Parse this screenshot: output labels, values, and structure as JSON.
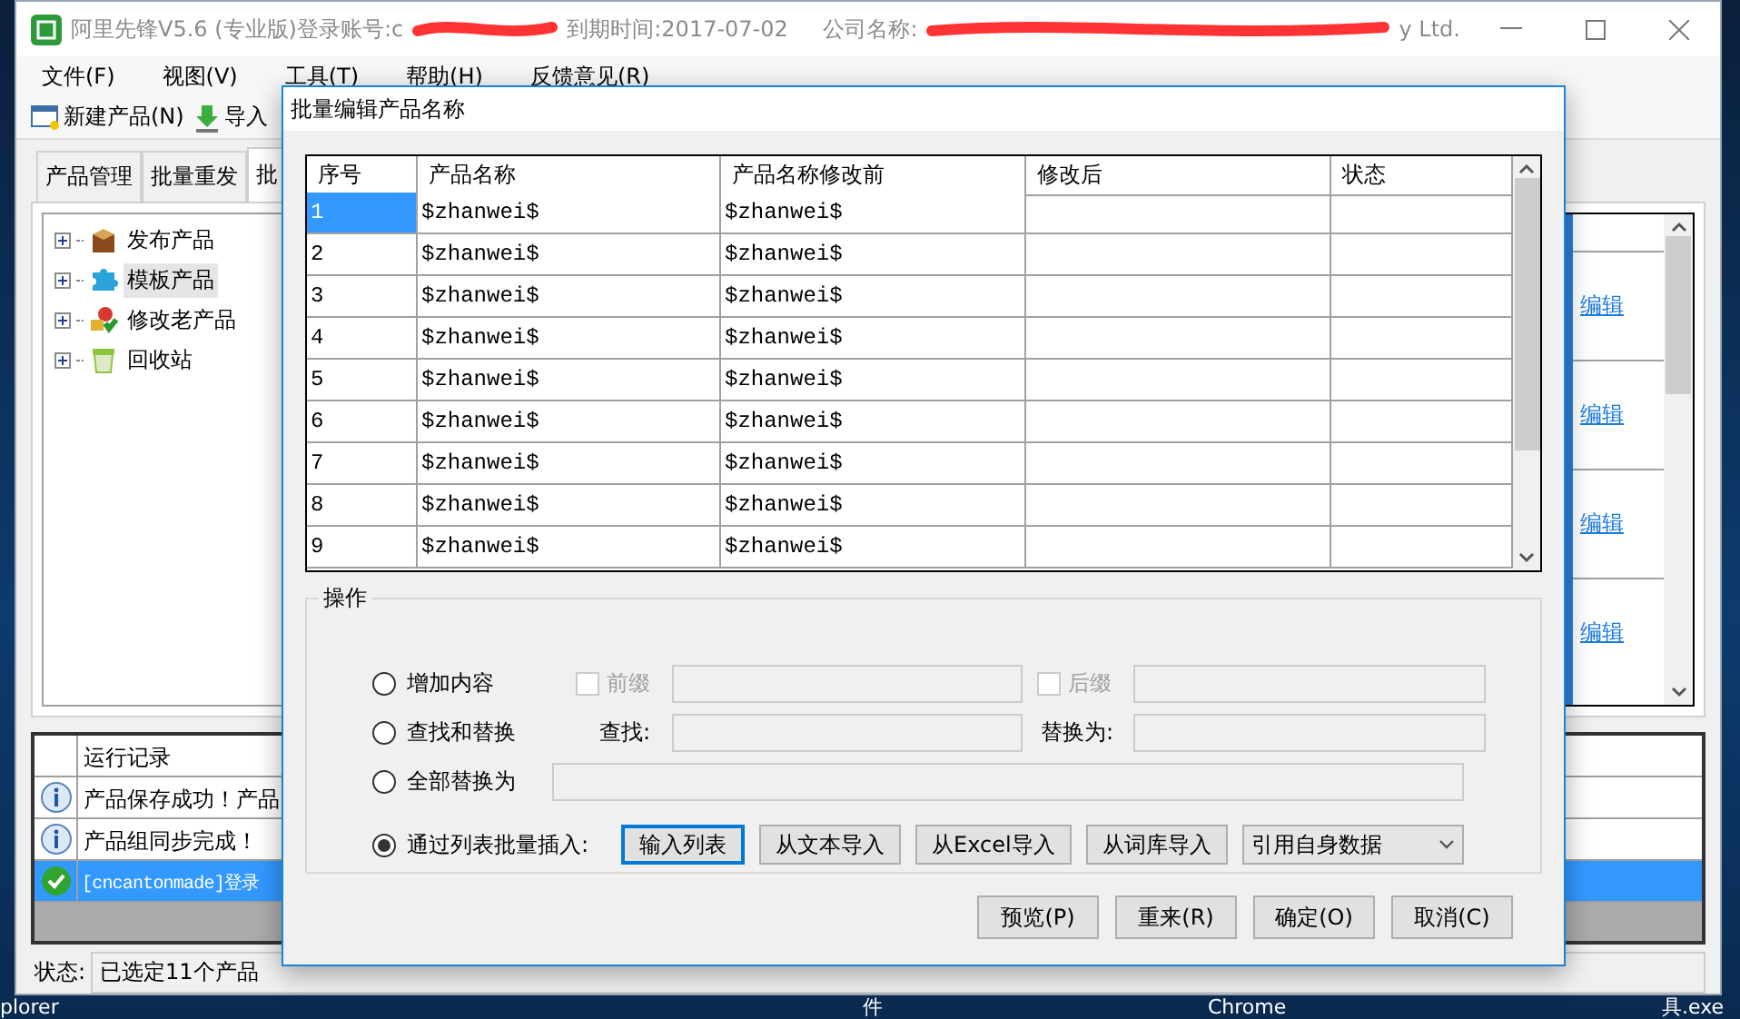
{
  "window": {
    "app_title": "阿里先锋V5.6 (专业版)登录账号:c",
    "expiry": "到期时间:2017-07-02",
    "company_label": "公司名称:",
    "company_tail": "y Ltd."
  },
  "menu": [
    "文件(F)",
    "视图(V)",
    "工具(T)",
    "帮助(H)",
    "反馈意见(R)"
  ],
  "toolbar": [
    {
      "kind": "new",
      "label": "新建产品(N)"
    },
    {
      "kind": "import",
      "label": "导入"
    }
  ],
  "tabs": [
    {
      "label": "产品管理",
      "selected": false
    },
    {
      "label": "批量重发",
      "selected": false
    },
    {
      "label": "批",
      "selected": true
    }
  ],
  "tree": [
    {
      "kind": "box",
      "label": "发布产品",
      "expanded": false,
      "selected": false
    },
    {
      "kind": "puzzle",
      "label": "模板产品",
      "expanded": false,
      "selected": true
    },
    {
      "kind": "mixed",
      "label": "修改老产品",
      "expanded": false,
      "selected": false
    },
    {
      "kind": "bin",
      "label": "回收站",
      "expanded": false,
      "selected": false
    }
  ],
  "product_list": {
    "links": [
      "编辑",
      "编辑",
      "编辑",
      "编辑"
    ]
  },
  "log": {
    "header": "运行记录",
    "rows": [
      {
        "kind": "info",
        "text": "产品保存成功！产品",
        "selected": false
      },
      {
        "kind": "info",
        "text": "产品组同步完成！",
        "selected": false
      },
      {
        "kind": "success",
        "text": "[cncantonmade]登录",
        "selected": true
      }
    ]
  },
  "status_bar": {
    "label": "状态:",
    "value": "已选定11个产品"
  },
  "desktop_labels": [
    "plorer",
    "件",
    "Chrome",
    "具.exe"
  ],
  "dialog": {
    "title": "批量编辑产品名称",
    "grid": {
      "columns": [
        "序号",
        "产品名称",
        "产品名称修改前",
        "修改后",
        "状态"
      ],
      "rows": [
        {
          "no": "1",
          "name": "$zhanwei$",
          "before": "$zhanwei$",
          "selected": true
        },
        {
          "no": "2",
          "name": "$zhanwei$",
          "before": "$zhanwei$",
          "selected": false
        },
        {
          "no": "3",
          "name": "$zhanwei$",
          "before": "$zhanwei$",
          "selected": false
        },
        {
          "no": "4",
          "name": "$zhanwei$",
          "before": "$zhanwei$",
          "selected": false
        },
        {
          "no": "5",
          "name": "$zhanwei$",
          "before": "$zhanwei$",
          "selected": false
        },
        {
          "no": "6",
          "name": "$zhanwei$",
          "before": "$zhanwei$",
          "selected": false
        },
        {
          "no": "7",
          "name": "$zhanwei$",
          "before": "$zhanwei$",
          "selected": false
        },
        {
          "no": "8",
          "name": "$zhanwei$",
          "before": "$zhanwei$",
          "selected": false
        },
        {
          "no": "9",
          "name": "$zhanwei$",
          "before": "$zhanwei$",
          "selected": false
        }
      ]
    },
    "operation": {
      "title": "操作",
      "options": [
        {
          "kind": "affix",
          "label": "增加内容",
          "selected": false,
          "prefix": {
            "label": "前缀",
            "checked": false
          },
          "suffix": {
            "label": "后缀",
            "checked": false
          }
        },
        {
          "kind": "find",
          "label": "查找和替换",
          "selected": false,
          "find_label": "查找:",
          "replace_label": "替换为:"
        },
        {
          "kind": "replace_all",
          "label": "全部替换为",
          "selected": false
        },
        {
          "kind": "list",
          "label": "通过列表批量插入:",
          "selected": true,
          "buttons": [
            {
              "label": "输入列表",
              "focused": true
            },
            {
              "label": "从文本导入",
              "focused": false
            },
            {
              "label": "从Excel导入",
              "focused": false
            },
            {
              "label": "从词库导入",
              "focused": false
            }
          ],
          "select": "引用自身数据"
        }
      ]
    },
    "buttons": [
      "预览(P)",
      "重来(R)",
      "确定(O)",
      "取消(C)"
    ]
  }
}
